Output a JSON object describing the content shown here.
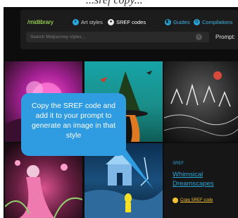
{
  "header": {
    "logo": "/midlibrary",
    "nav": [
      {
        "label": "Art styles",
        "icon": "palette-icon"
      },
      {
        "label": "SREF codes",
        "icon": "sref-icon"
      },
      {
        "label": "Guides",
        "icon": "book-icon"
      },
      {
        "label": "Compilations",
        "icon": "stack-icon"
      }
    ],
    "search": {
      "placeholder": "Search Midjourney styles..."
    },
    "prompt_label": "Prompt:"
  },
  "gallery": {
    "images": [
      {
        "subject": "pink flower fantasy artwork"
      },
      {
        "subject": "witch with hat and birds on teal"
      },
      {
        "subject": "dark ink castle cityscape"
      },
      {
        "subject": "fairy girl in pink garden"
      },
      {
        "subject": "blue house with yellow figure"
      }
    ]
  },
  "info": {
    "kicker": "SREF",
    "title": "Whimsical Dreamscapes",
    "copy_label": "Copy SREF code"
  },
  "callout": {
    "text": "Copy the SREF code and add it to your prompt to generate an image in that style"
  },
  "colors": {
    "accent": "#2aa5d8",
    "logo": "#b7ff5c",
    "copy_link": "#f2c230",
    "callout_bg": "#2f9be0",
    "app_bg": "#0d0d0d"
  }
}
